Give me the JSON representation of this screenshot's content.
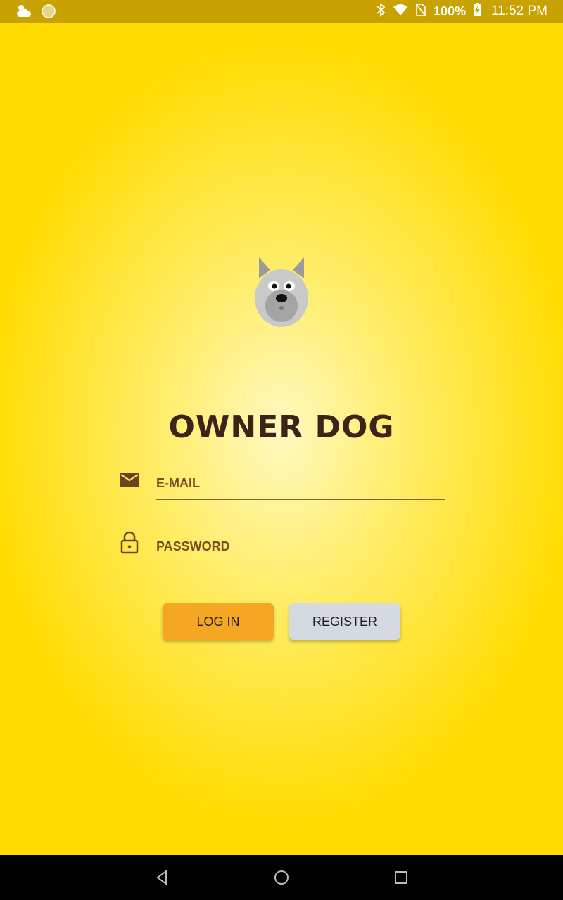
{
  "status_bar": {
    "battery": "100%",
    "time": "11:52 PM",
    "icons": [
      "weather-icon",
      "circle-app-icon",
      "bluetooth-icon",
      "wifi-icon",
      "no-sim-icon",
      "battery-charging-icon"
    ]
  },
  "app": {
    "title": "OWNER DOG",
    "logo": "dog-face-icon"
  },
  "form": {
    "email_placeholder": "E-MAIL",
    "password_placeholder": "PASSWORD",
    "email_value": "",
    "password_value": ""
  },
  "buttons": {
    "login_label": "LOG IN",
    "register_label": "REGISTER"
  },
  "nav": {
    "icons": [
      "back-icon",
      "home-icon",
      "recents-icon"
    ]
  },
  "colors": {
    "background": "#ffdb00",
    "status_bar": "#c8a200",
    "title": "#3e2418",
    "field_text": "#7a4e24",
    "login_button": "#f5a623",
    "register_button": "#d4dae0"
  }
}
